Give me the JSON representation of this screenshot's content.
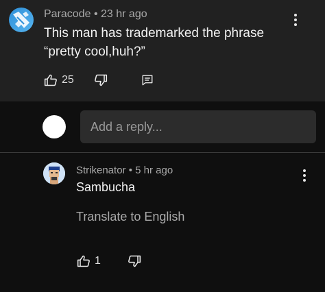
{
  "comment": {
    "author": "Paracode",
    "separator": "•",
    "time": "23 hr ago",
    "text": "This man has trademarked the phrase “pretty cool,huh?”",
    "like_count": "25"
  },
  "reply_box": {
    "placeholder": "Add a reply..."
  },
  "reply": {
    "author": "Strikenator",
    "separator": "•",
    "time": "5 hr ago",
    "text": "Sambucha",
    "translate_label": "Translate to English",
    "like_count": "1"
  },
  "icons": {
    "like": "thumbs-up-icon",
    "dislike": "thumbs-down-icon",
    "reply": "comment-icon",
    "menu": "more-vert-icon"
  },
  "colors": {
    "background": "#0f0f0f",
    "highlight_panel": "#212121",
    "primary_text": "#f1f1f1",
    "secondary_text": "#aaaaaa",
    "input_background": "#2c2c2c"
  }
}
